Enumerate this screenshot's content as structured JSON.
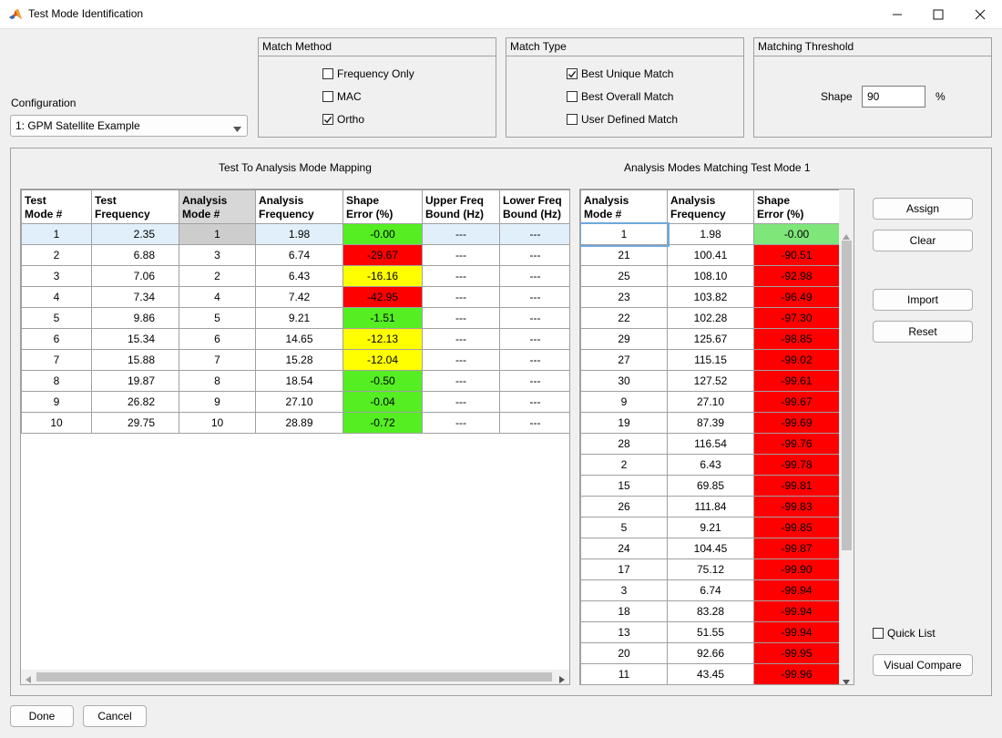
{
  "window": {
    "title": "Test Mode Identification",
    "app_icon": "matlab-icon",
    "controls": [
      "minimize-icon",
      "maximize-icon",
      "close-icon"
    ]
  },
  "configuration": {
    "label": "Configuration",
    "selected": "1: GPM Satellite Example"
  },
  "match_method": {
    "title": "Match Method",
    "options": [
      {
        "label": "Frequency Only",
        "checked": false
      },
      {
        "label": "MAC",
        "checked": false
      },
      {
        "label": "Ortho",
        "checked": true
      }
    ]
  },
  "match_type": {
    "title": "Match Type",
    "options": [
      {
        "label": "Best Unique Match",
        "checked": true
      },
      {
        "label": "Best Overall Match",
        "checked": false
      },
      {
        "label": "User Defined Match",
        "checked": false
      }
    ]
  },
  "threshold": {
    "title": "Matching Threshold",
    "label": "Shape",
    "value": "90",
    "unit": "%"
  },
  "mapping_table": {
    "title": "Test To Analysis Mode Mapping",
    "headers": [
      [
        "Test",
        "Mode #"
      ],
      [
        "Test",
        "Frequency"
      ],
      [
        "Analysis",
        "Mode #"
      ],
      [
        "Analysis",
        "Frequency"
      ],
      [
        "Shape",
        "Error (%)"
      ],
      [
        "Upper Freq",
        "Bound (Hz)"
      ],
      [
        "Lower Freq",
        "Bound (Hz)"
      ]
    ],
    "rows": [
      {
        "cells": [
          "1",
          "2.35",
          "1",
          "1.98",
          "-0.00",
          "---",
          "---"
        ],
        "status": "green"
      },
      {
        "cells": [
          "2",
          "6.88",
          "3",
          "6.74",
          "-29.67",
          "---",
          "---"
        ],
        "status": "red"
      },
      {
        "cells": [
          "3",
          "7.06",
          "2",
          "6.43",
          "-16.16",
          "---",
          "---"
        ],
        "status": "yellow"
      },
      {
        "cells": [
          "4",
          "7.34",
          "4",
          "7.42",
          "-42.95",
          "---",
          "---"
        ],
        "status": "red"
      },
      {
        "cells": [
          "5",
          "9.86",
          "5",
          "9.21",
          "-1.51",
          "---",
          "---"
        ],
        "status": "green"
      },
      {
        "cells": [
          "6",
          "15.34",
          "6",
          "14.65",
          "-12.13",
          "---",
          "---"
        ],
        "status": "yellow"
      },
      {
        "cells": [
          "7",
          "15.88",
          "7",
          "15.28",
          "-12.04",
          "---",
          "---"
        ],
        "status": "yellow"
      },
      {
        "cells": [
          "8",
          "19.87",
          "8",
          "18.54",
          "-0.50",
          "---",
          "---"
        ],
        "status": "green"
      },
      {
        "cells": [
          "9",
          "26.82",
          "9",
          "27.10",
          "-0.04",
          "---",
          "---"
        ],
        "status": "green"
      },
      {
        "cells": [
          "10",
          "29.75",
          "10",
          "28.89",
          "-0.72",
          "---",
          "---"
        ],
        "status": "green"
      }
    ]
  },
  "analysis_table": {
    "title": "Analysis Modes Matching Test Mode 1",
    "headers": [
      [
        "Analysis",
        "Mode #"
      ],
      [
        "Analysis",
        "Frequency"
      ],
      [
        "Shape",
        "Error (%)"
      ]
    ],
    "rows": [
      {
        "cells": [
          "1",
          "1.98",
          "-0.00"
        ],
        "status": "lgreen"
      },
      {
        "cells": [
          "21",
          "100.41",
          "-90.51"
        ],
        "status": "red"
      },
      {
        "cells": [
          "25",
          "108.10",
          "-92.98"
        ],
        "status": "red"
      },
      {
        "cells": [
          "23",
          "103.82",
          "-96.49"
        ],
        "status": "red"
      },
      {
        "cells": [
          "22",
          "102.28",
          "-97.30"
        ],
        "status": "red"
      },
      {
        "cells": [
          "29",
          "125.67",
          "-98.85"
        ],
        "status": "red"
      },
      {
        "cells": [
          "27",
          "115.15",
          "-99.02"
        ],
        "status": "red"
      },
      {
        "cells": [
          "30",
          "127.52",
          "-99.61"
        ],
        "status": "red"
      },
      {
        "cells": [
          "9",
          "27.10",
          "-99.67"
        ],
        "status": "red"
      },
      {
        "cells": [
          "19",
          "87.39",
          "-99.69"
        ],
        "status": "red"
      },
      {
        "cells": [
          "28",
          "116.54",
          "-99.76"
        ],
        "status": "red"
      },
      {
        "cells": [
          "2",
          "6.43",
          "-99.78"
        ],
        "status": "red"
      },
      {
        "cells": [
          "15",
          "69.85",
          "-99.81"
        ],
        "status": "red"
      },
      {
        "cells": [
          "26",
          "111.84",
          "-99.83"
        ],
        "status": "red"
      },
      {
        "cells": [
          "5",
          "9.21",
          "-99.85"
        ],
        "status": "red"
      },
      {
        "cells": [
          "24",
          "104.45",
          "-99.87"
        ],
        "status": "red"
      },
      {
        "cells": [
          "17",
          "75.12",
          "-99.90"
        ],
        "status": "red"
      },
      {
        "cells": [
          "3",
          "6.74",
          "-99.94"
        ],
        "status": "red"
      },
      {
        "cells": [
          "18",
          "83.28",
          "-99.94"
        ],
        "status": "red"
      },
      {
        "cells": [
          "13",
          "51.55",
          "-99.94"
        ],
        "status": "red"
      },
      {
        "cells": [
          "20",
          "92.66",
          "-99.95"
        ],
        "status": "red"
      },
      {
        "cells": [
          "11",
          "43.45",
          "-99.96"
        ],
        "status": "red"
      }
    ]
  },
  "buttons": {
    "assign": "Assign",
    "clear": "Clear",
    "import": "Import",
    "reset": "Reset",
    "visual_compare": "Visual Compare",
    "done": "Done",
    "cancel": "Cancel"
  },
  "quick_list": {
    "label": "Quick List",
    "checked": false
  },
  "colors": {
    "green": "#55ee22",
    "light_green": "#7fe67a",
    "yellow": "#ffff00",
    "red": "#ff0000",
    "selection": "#e1effa"
  }
}
